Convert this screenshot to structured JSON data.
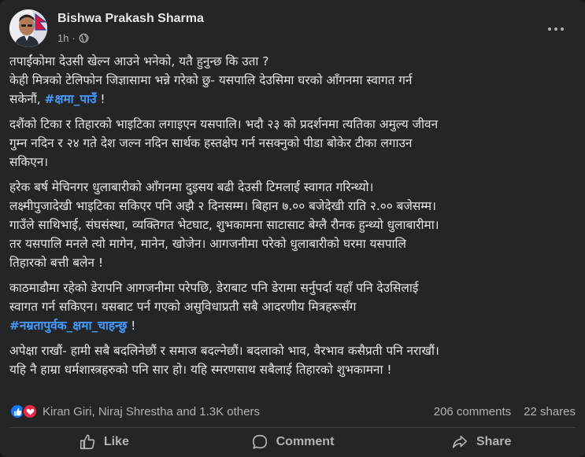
{
  "post": {
    "author": "Bishwa Prakash Sharma",
    "time": "1h",
    "time_separator": "·",
    "paragraphs": [
      {
        "lines": [
          [
            {
              "text": "तपाईंकोमा देउसी खेल्न आउने भनेको, यतै हुनुन्छ कि उता ?"
            }
          ],
          [
            {
              "text": "केही मित्रको टेलिफोन जिज्ञासामा भन्ने गरेको छु- यसपालि देउसिमा घरको आँगनमा स्वागत गर्न"
            }
          ],
          [
            {
              "text": "सकेनौं, "
            },
            {
              "text": "#क्षमा_पाउँ",
              "hashtag": true
            },
            {
              "text": " !"
            }
          ]
        ]
      },
      {
        "lines": [
          [
            {
              "text": "दशैंको टिका र तिहारको भाइटिका लगाइएन यसपालि। भदौ २३ को प्रदर्शनमा त्यतिका अमुल्य जीवन"
            }
          ],
          [
            {
              "text": "गुम्न नदिन र २४ गते देश जल्न नदिन सार्थक हस्तक्षेप गर्न नसक्नुको पीडा बोकेर टीका लगाउन"
            }
          ],
          [
            {
              "text": "सकिएन।"
            }
          ]
        ]
      },
      {
        "lines": [
          [
            {
              "text": "हरेक बर्ष मेचिनगर धुलाबारीको आँगनमा दुइसय बढी देउसी टिमलाई स्वागत गरिन्थ्यो।"
            }
          ],
          [
            {
              "text": "लक्ष्मीपुजादेखी भाइटिका सकिएर पनि अझै २ दिनसम्म। बिहान ७.०० बजेदेखी राति २.०० बजेसम्म।"
            }
          ],
          [
            {
              "text": "गाउँले साथिभाई, संघसंस्था, व्यक्तिगत भेटघाट, शुभकामना साटासाट बेग्लै रौनक हुन्थ्यो धुलाबारीमा।"
            }
          ],
          [
            {
              "text": "तर यसपालि मनले त्यो मागेन, मानेन, खोजेन। आगजनीमा परेको धुलाबारीको घरमा यसपालि"
            }
          ],
          [
            {
              "text": "तिहारको बत्ती बलेन !"
            }
          ]
        ]
      },
      {
        "lines": [
          [
            {
              "text": "काठमाडौमा रहेकोे डेरापनि आगजनीमा परेपछि, डेराबाट पनि डेरामा सर्नुपर्दा यहाँ पनि देउसिलाई"
            }
          ],
          [
            {
              "text": "स्वागत गर्न सकिएन। यसबाट पर्न गएको असुविधाप्रती सबै आदरणीय मित्रहरूसँग"
            }
          ],
          [
            {
              "text": "#नम्रतापुर्वक_क्षमा_चाहन्छु",
              "hashtag": true
            },
            {
              "text": " !"
            }
          ]
        ]
      },
      {
        "lines": [
          [
            {
              "text": "अपेक्षा राखौं- हामी सबै बदलिनेछौं र समाज बदल्नेछौं। बदलाको भाव, वैरभाव कसैप्रती पनि नराखौं।"
            }
          ],
          [
            {
              "text": "यहि नै हाम्रा धर्मशास्त्रहरुको पनि सार हो। यहि स्मरणसाथ सबैलाई तिहारको शुभकामना !"
            }
          ]
        ]
      }
    ]
  },
  "reactions": {
    "summary": "Kiran Giri, Niraj Shrestha and 1.3K others",
    "comments": "206 comments",
    "shares": "22 shares"
  },
  "actions": {
    "like": "Like",
    "comment": "Comment",
    "share": "Share"
  },
  "icons": {
    "more": "more-options-icon",
    "privacy": "globe-icon",
    "like": "thumbs-up-icon",
    "love": "heart-icon",
    "comment": "comment-bubble-icon",
    "share": "share-arrow-icon"
  },
  "colors": {
    "card_bg": "#242526",
    "page_bg": "#18191a",
    "text_primary": "#e4e6eb",
    "text_secondary": "#b0b3b8",
    "hashtag": "#4599ff",
    "like_blue": "#1877f2",
    "love_red": "#f0284a"
  }
}
